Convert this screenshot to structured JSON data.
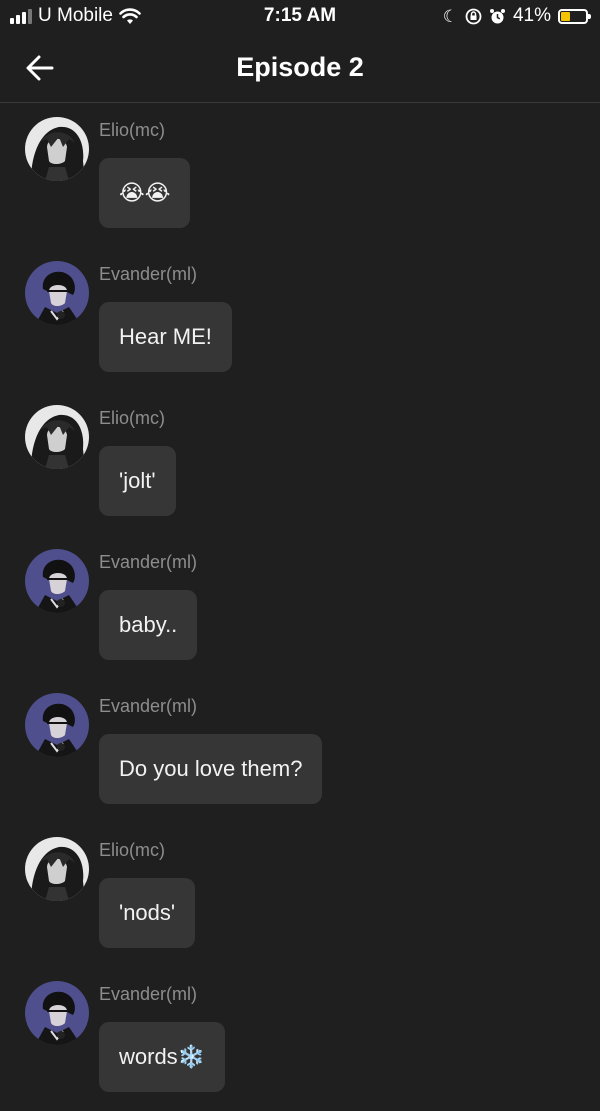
{
  "status_bar": {
    "carrier": "U Mobile",
    "time": "7:15 AM",
    "battery": "41%",
    "battery_level": 0.41,
    "icons": [
      "signal-icon",
      "wifi-icon",
      "moon-icon",
      "orientation-lock-icon",
      "alarm-icon",
      "battery-icon"
    ]
  },
  "header": {
    "title": "Episode 2",
    "back_icon": "arrow-left-icon"
  },
  "messages": [
    {
      "sender": "Elio(mc)",
      "text": "😭😭",
      "avatar": "elio"
    },
    {
      "sender": "Evander(ml)",
      "text": "Hear ME!",
      "avatar": "evander"
    },
    {
      "sender": "Elio(mc)",
      "text": "'jolt'",
      "avatar": "elio"
    },
    {
      "sender": "Evander(ml)",
      "text": "baby..",
      "avatar": "evander"
    },
    {
      "sender": "Evander(ml)",
      "text": "Do you love them?",
      "avatar": "evander"
    },
    {
      "sender": "Elio(mc)",
      "text": "'nods'",
      "avatar": "elio"
    },
    {
      "sender": "Evander(ml)",
      "text": "words❄️",
      "avatar": "evander"
    }
  ],
  "colors": {
    "background": "#1f1f1f",
    "bubble": "#363636",
    "sender_name": "#8d8d8d",
    "battery_fill": "#f5c400"
  }
}
